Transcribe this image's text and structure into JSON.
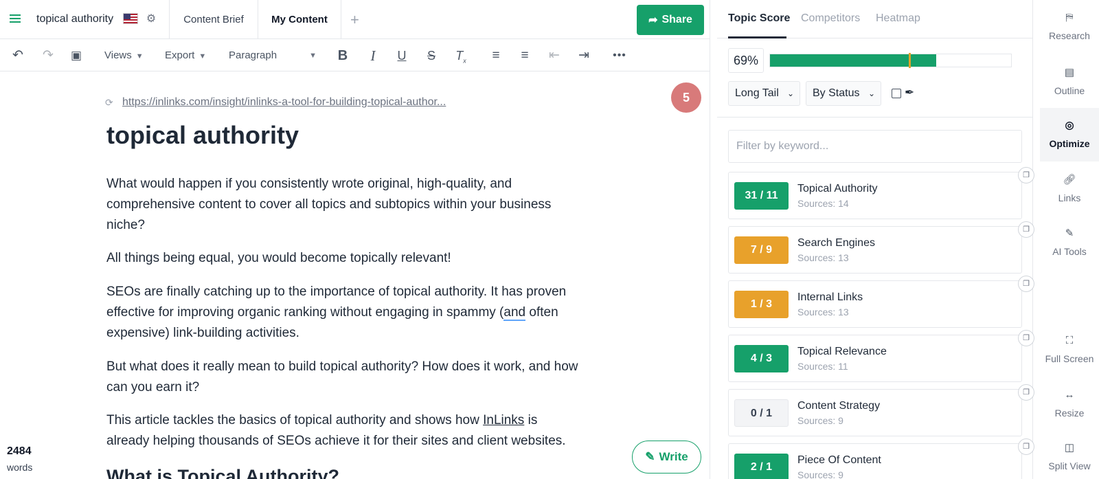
{
  "header": {
    "doc_title": "topical authority",
    "tabs": [
      "Content Brief",
      "My Content"
    ],
    "share_label": "Share"
  },
  "toolbar": {
    "views_label": "Views",
    "export_label": "Export",
    "format_label": "Paragraph"
  },
  "editor": {
    "source_url": "https://inlinks.com/insight/inlinks-a-tool-for-building-topical-author...",
    "badge_count": "5",
    "heading": "topical authority",
    "paragraphs": [
      {
        "lines": [
          "What would happen if you consistently wrote original, high-quality, and",
          "comprehensive content to cover all topics and subtopics within your business",
          "niche?"
        ]
      },
      {
        "lines": [
          "All things being equal, you would become topically relevant!"
        ]
      },
      {
        "lines_a": [
          "SEOs are finally catching up to the importance of topical authority. It has proven",
          "effective for improving organic ranking without engaging in spammy ("
        ],
        "squiggle": "and",
        "lines_b": [
          " often",
          "expensive) link-building activities."
        ]
      },
      {
        "lines": [
          "But what does it really mean to build topical authority? How does it work, and how",
          "can you earn it?"
        ]
      },
      {
        "pre": "This article tackles the basics of topical authority and shows how ",
        "link": "InLinks",
        "post": " is",
        "line2": "already helping thousands of SEOs achieve it for their sites and client websites."
      }
    ],
    "subheading": "What is Topical Authority?",
    "word_count": "2484",
    "word_label": "words",
    "write_label": "Write"
  },
  "panel": {
    "tabs": [
      "Topic Score",
      "Competitors",
      "Heatmap"
    ],
    "score_text": "69%",
    "score_value": 0.69,
    "filter1": "Long Tail",
    "filter2": "By Status",
    "search_placeholder": "Filter by keyword...",
    "keywords": [
      {
        "count": "31 / 11",
        "name": "Topical Authority",
        "sources": "Sources: 14",
        "status": "green"
      },
      {
        "count": "7 / 9",
        "name": "Search Engines",
        "sources": "Sources: 13",
        "status": "orange"
      },
      {
        "count": "1 / 3",
        "name": "Internal Links",
        "sources": "Sources: 13",
        "status": "orange"
      },
      {
        "count": "4 / 3",
        "name": "Topical Relevance",
        "sources": "Sources: 11",
        "status": "green"
      },
      {
        "count": "0 / 1",
        "name": "Content Strategy",
        "sources": "Sources: 9",
        "status": "grey"
      },
      {
        "count": "2 / 1",
        "name": "Piece Of Content",
        "sources": "Sources: 9",
        "status": "green"
      }
    ]
  },
  "rail": {
    "items": [
      "Research",
      "Outline",
      "Optimize",
      "Links",
      "AI Tools",
      "Full Screen",
      "Resize",
      "Split View"
    ]
  },
  "colors": {
    "accent": "#16a06a",
    "orange": "#e8a12b",
    "grey_pill": "#f3f4f6",
    "badge": "#d87a7a"
  }
}
